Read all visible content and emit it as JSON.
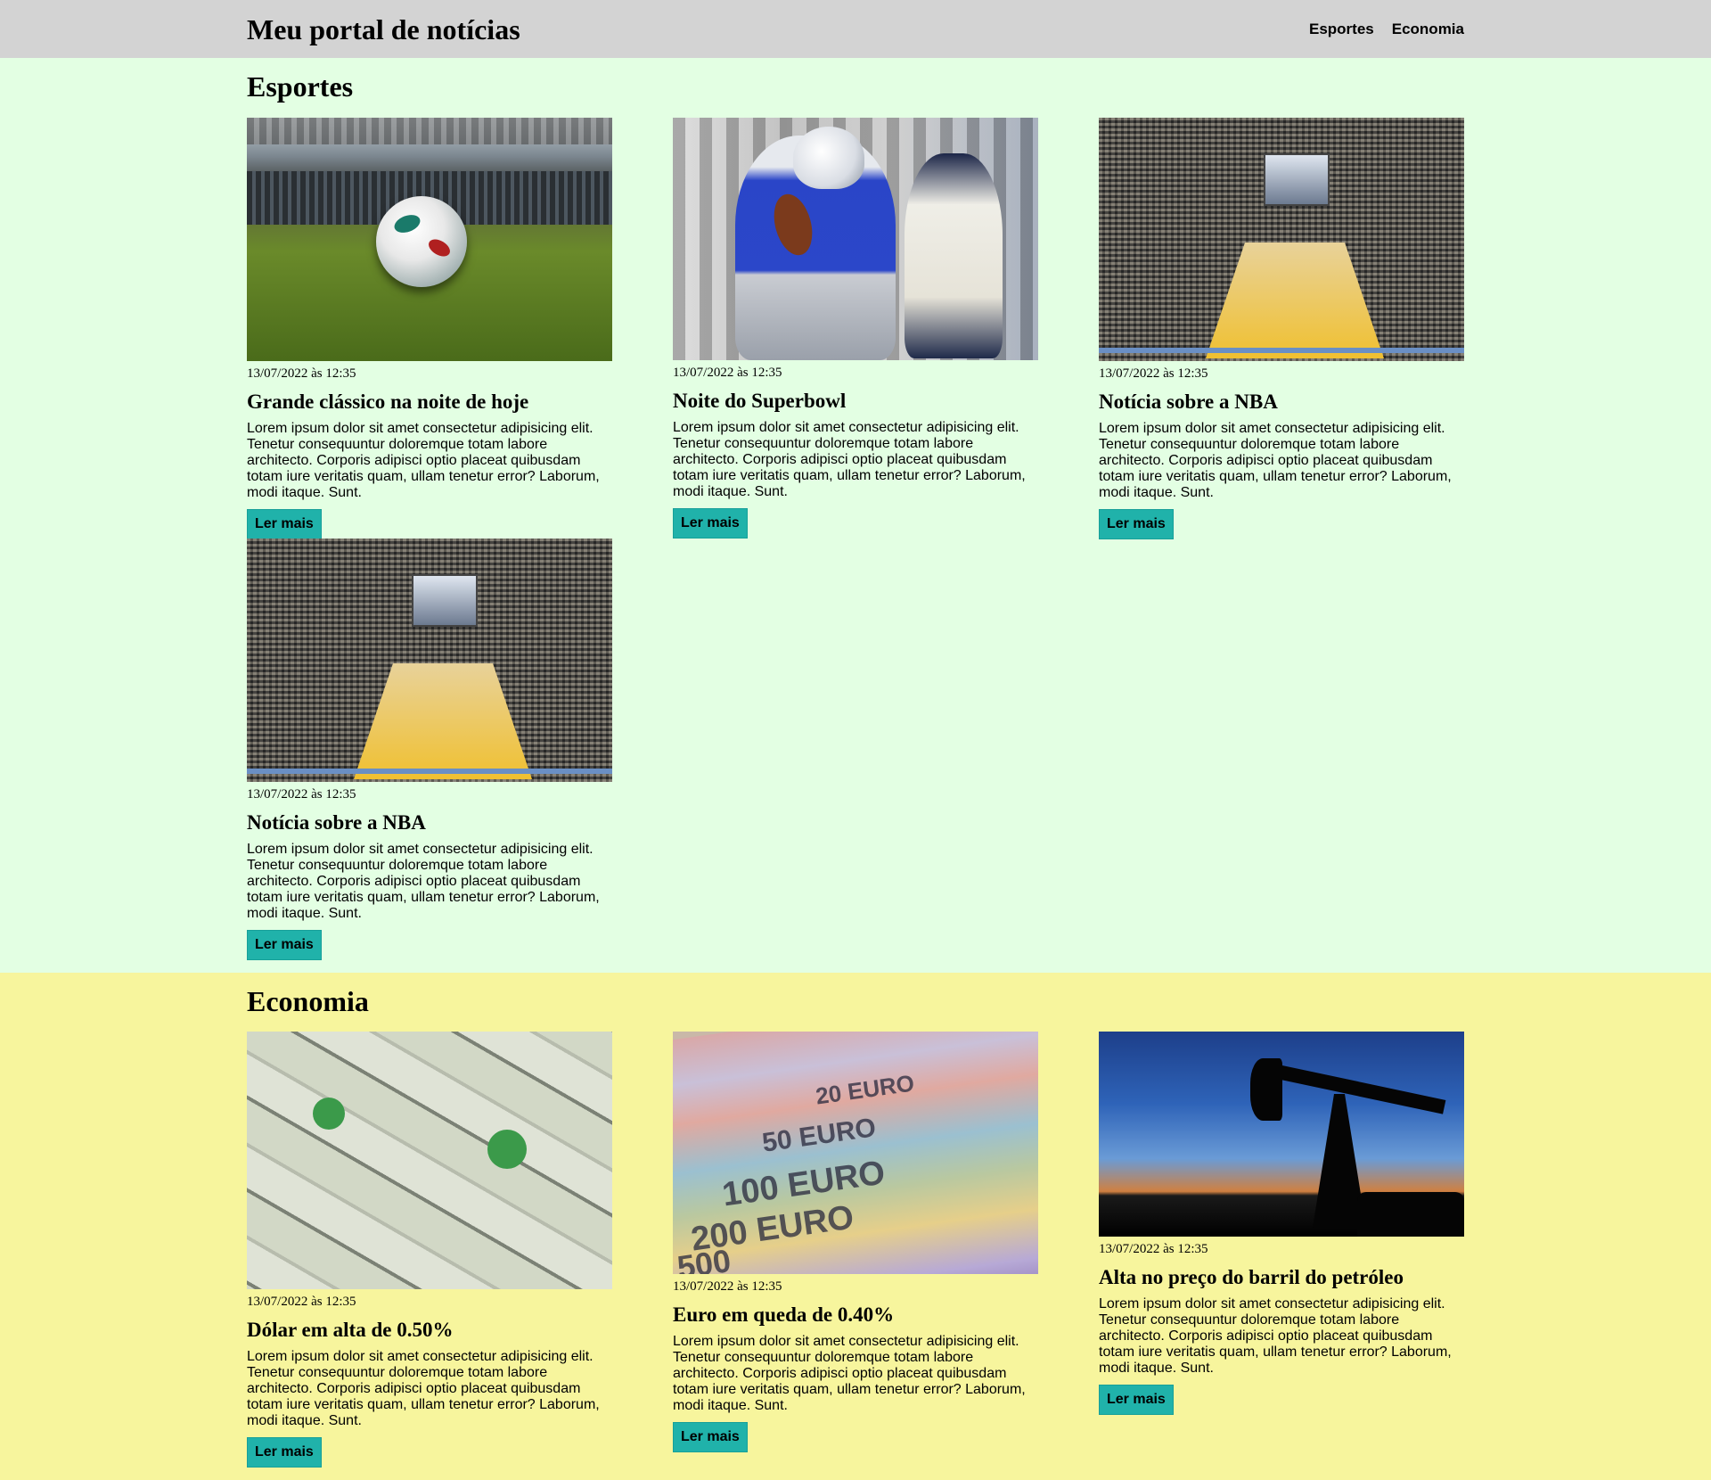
{
  "header": {
    "site_title": "Meu portal de notícias",
    "nav": [
      "Esportes",
      "Economia"
    ]
  },
  "sports": {
    "title": "Esportes",
    "articles": [
      {
        "image": "soccer-ball-stadium",
        "date": "13/07/2022 às 12:35",
        "headline": "Grande clássico na noite de hoje",
        "body": "Lorem ipsum dolor sit amet consectetur adipisicing elit. Tenetur consequuntur doloremque totam labore architecto. Corporis adipisci optio placeat quibusdam totam iure veritatis quam, ullam tenetur error? Laborum, modi itaque. Sunt.",
        "button": "Ler mais"
      },
      {
        "image": "american-football-player",
        "date": "13/07/2022 às 12:35",
        "headline": "Noite do Superbowl",
        "body": "Lorem ipsum dolor sit amet consectetur adipisicing elit. Tenetur consequuntur doloremque totam labore architecto. Corporis adipisci optio placeat quibusdam totam iure veritatis quam, ullam tenetur error? Laborum, modi itaque. Sunt.",
        "button": "Ler mais"
      },
      {
        "image": "basketball-arena",
        "date": "13/07/2022 às 12:35",
        "headline": "Notícia sobre a NBA",
        "body": "Lorem ipsum dolor sit amet consectetur adipisicing elit. Tenetur consequuntur doloremque totam labore architecto. Corporis adipisci optio placeat quibusdam totam iure veritatis quam, ullam tenetur error? Laborum, modi itaque. Sunt.",
        "button": "Ler mais"
      },
      {
        "image": "basketball-arena",
        "date": "13/07/2022 às 12:35",
        "headline": "Notícia sobre a NBA",
        "body": "Lorem ipsum dolor sit amet consectetur adipisicing elit. Tenetur consequuntur doloremque totam labore architecto. Corporis adipisci optio placeat quibusdam totam iure veritatis quam, ullam tenetur error? Laborum, modi itaque. Sunt.",
        "button": "Ler mais"
      }
    ]
  },
  "economy": {
    "title": "Economia",
    "articles": [
      {
        "image": "dollar-bills",
        "date": "13/07/2022 às 12:35",
        "headline": "Dólar em alta de 0.50%",
        "body": "Lorem ipsum dolor sit amet consectetur adipisicing elit. Tenetur consequuntur doloremque totam labore architecto. Corporis adipisci optio placeat quibusdam totam iure veritatis quam, ullam tenetur error? Laborum, modi itaque. Sunt.",
        "button": "Ler mais"
      },
      {
        "image": "euro-banknotes",
        "image_text": [
          "20 EURO",
          "50 EURO",
          "100 EURO",
          "200 EURO",
          "500"
        ],
        "date": "13/07/2022 às 12:35",
        "headline": "Euro em queda de 0.40%",
        "body": "Lorem ipsum dolor sit amet consectetur adipisicing elit. Tenetur consequuntur doloremque totam labore architecto. Corporis adipisci optio placeat quibusdam totam iure veritatis quam, ullam tenetur error? Laborum, modi itaque. Sunt.",
        "button": "Ler mais"
      },
      {
        "image": "oil-pump-silhouette",
        "date": "13/07/2022 às 12:35",
        "headline": "Alta no preço do barril do petróleo",
        "body": "Lorem ipsum dolor sit amet consectetur adipisicing elit. Tenetur consequuntur doloremque totam labore architecto. Corporis adipisci optio placeat quibusdam totam iure veritatis quam, ullam tenetur error? Laborum, modi itaque. Sunt.",
        "button": "Ler mais"
      }
    ]
  },
  "colors": {
    "header_bg": "#d3d3d3",
    "sports_bg": "#e3ffe3",
    "economy_bg": "#f7f59d",
    "button_bg": "#20b2aa"
  }
}
